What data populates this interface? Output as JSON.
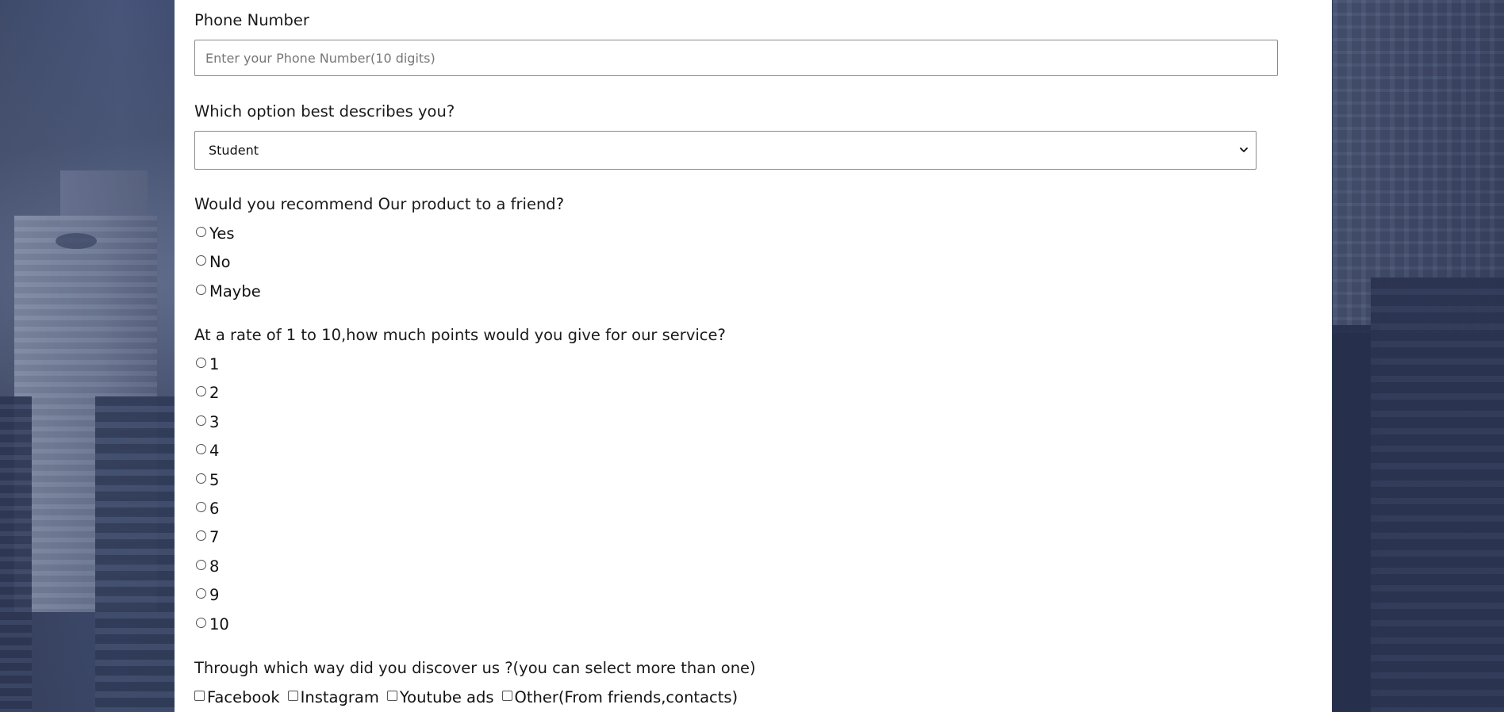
{
  "form": {
    "phone": {
      "label": "Phone Number",
      "placeholder": "Enter your Phone Number(10 digits)",
      "value": ""
    },
    "role": {
      "label": "Which option best describes you?",
      "selected": "Student"
    },
    "recommend": {
      "label": "Would you recommend Our product to a friend?",
      "options": [
        "Yes",
        "No",
        "Maybe"
      ]
    },
    "rating": {
      "label": "At a rate of 1 to 10,how much points would you give for our service?",
      "options": [
        "1",
        "2",
        "3",
        "4",
        "5",
        "6",
        "7",
        "8",
        "9",
        "10"
      ]
    },
    "discovery": {
      "label": "Through which way did you discover us ?(you can select more than one)",
      "options": [
        "Facebook",
        "Instagram",
        "Youtube ads",
        "Other(From friends,contacts)"
      ]
    }
  },
  "icons": {
    "select_arrow": "chevron-down-icon",
    "radio": "radio-unchecked-icon",
    "checkbox": "checkbox-unchecked-icon"
  },
  "colors": {
    "card_background": "#ffffff",
    "page_background": "#36425f",
    "input_border": "#8a8a8a",
    "text": "#1a1a1a"
  }
}
